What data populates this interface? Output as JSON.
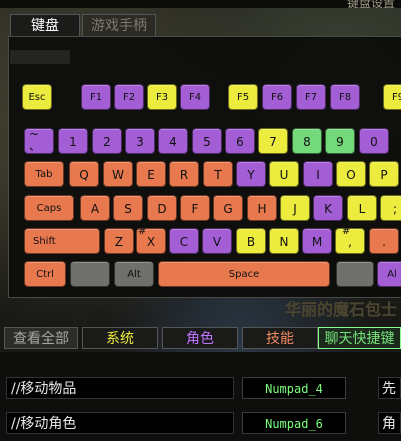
{
  "header": {
    "right_text": "键盘设置"
  },
  "tabs": {
    "keyboard": "键盘",
    "gamepad": "游戏手柄"
  },
  "keys": {
    "esc": "Esc",
    "f1": "F1",
    "f2": "F2",
    "f3": "F3",
    "f4": "F4",
    "f5": "F5",
    "f6": "F6",
    "f7": "F7",
    "f8": "F8",
    "f9": "F9",
    "tilde_top": "~",
    "tilde_bottom": "、",
    "n1": "1",
    "n2": "2",
    "n3": "3",
    "n4": "4",
    "n5": "5",
    "n6": "6",
    "n7": "7",
    "n8": "8",
    "n9": "9",
    "n0": "0",
    "tab": "Tab",
    "q": "Q",
    "w": "W",
    "e": "E",
    "r": "R",
    "t": "T",
    "yk": "Y",
    "u": "U",
    "i": "I",
    "ok": "O",
    "pk": "P",
    "caps": "Caps",
    "a": "A",
    "s": "S",
    "d": "D",
    "f": "F",
    "gk": "G",
    "h": "H",
    "j": "J",
    "k": "K",
    "l": "L",
    "semi": ";",
    "shift": "Shift",
    "z": "Z",
    "x": "X",
    "x_top": "#",
    "c": "C",
    "v": "V",
    "b": "B",
    "n": "N",
    "m": "M",
    "comma_top": "#",
    "comma": ",",
    "dot": ".",
    "ctrl": "Ctrl",
    "alt": "Alt",
    "space": "Space",
    "alt_right": "Al"
  },
  "background_text": "华丽的魔石包士",
  "categories": {
    "all": "查看全部",
    "system": "系统",
    "role": "角色",
    "skill": "技能",
    "chat": "聊天快捷键"
  },
  "mappings": [
    {
      "action": "//移动物品",
      "binding": "Numpad_4",
      "extra": "先"
    },
    {
      "action": "//移动角色",
      "binding": "Numpad_6",
      "extra": "角"
    }
  ],
  "colors": {
    "key_yellow": "#ecec3e",
    "key_purple": "#a35ed6",
    "key_orange": "#e8794f",
    "key_green": "#74d97b",
    "key_gray": "#6f6f6c",
    "binding_green": "#7cff7c"
  }
}
